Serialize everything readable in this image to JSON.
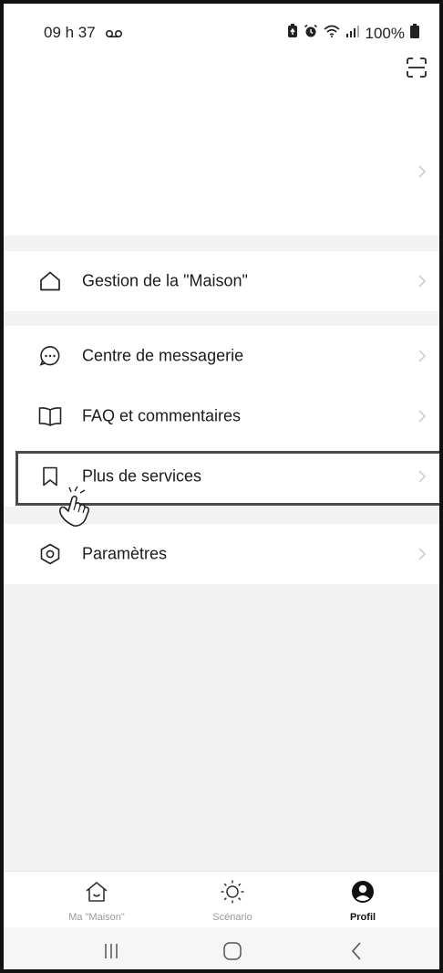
{
  "status_bar": {
    "time": "09 h 37",
    "battery": "100%",
    "icons": [
      "voicemail-icon",
      "battery-saver-icon",
      "alarm-icon",
      "wifi-icon",
      "signal-icon",
      "battery-icon"
    ]
  },
  "header": {
    "scan_icon": "scan-icon",
    "profile_chevron": "chevron-right-icon"
  },
  "menu": {
    "home": {
      "label": "Gestion de la \"Maison\"",
      "icon": "house-icon"
    },
    "messages": {
      "label": "Centre de messagerie",
      "icon": "message-icon"
    },
    "faq": {
      "label": "FAQ et commentaires",
      "icon": "book-icon"
    },
    "services": {
      "label": "Plus de services",
      "icon": "bookmark-icon"
    },
    "settings": {
      "label": "Paramètres",
      "icon": "settings-icon"
    }
  },
  "tabs": [
    {
      "label": "Ma \"Maison\"",
      "icon": "home-outline-icon",
      "active": false
    },
    {
      "label": "Scénario",
      "icon": "sun-icon",
      "active": false
    },
    {
      "label": "Profil",
      "icon": "user-circle-icon",
      "active": true
    }
  ],
  "colors": {
    "background": "#f2f2f2",
    "card": "#ffffff",
    "text": "#1b1b1b",
    "muted": "#9a9a9a",
    "chevron": "#c8c8c8",
    "highlight": "#4a4a4a"
  }
}
